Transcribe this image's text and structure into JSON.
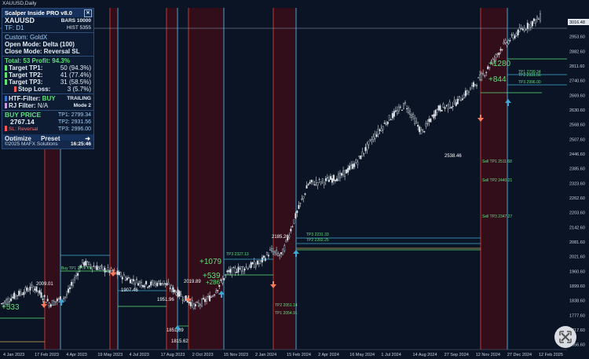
{
  "window": {
    "title": "XAUUSD,Daily"
  },
  "panel": {
    "title": "Scalper Inside PRO v8.0",
    "symbol": "XAUUSD",
    "tf": "TF: D1",
    "bars_label": "BARS",
    "bars": "10000",
    "hist_label": "HIST",
    "hist": "5355",
    "custom": "Custom: GoldX",
    "open_mode": "Open Mode: Delta (100)",
    "close_mode": "Close Mode: Reversal SL",
    "total": "Total: 53  Profit: 94.3%",
    "tp1": "Target TP1:",
    "tp1v": "50 (94.3%)",
    "tp2": "Target TP2:",
    "tp2v": "41 (77.4%)",
    "tp3": "Target TP3:",
    "tp3v": "31 (58.5%)",
    "sl": "Stop Loss:",
    "slv": "3 (5.7%)",
    "htf": "HTF-Filter:",
    "htfv": "BUY",
    "rj": "RJ Filter:",
    "rjv": "N/A",
    "trailing": "TRAILING",
    "mode": "Mode 2",
    "buy_price": "BUY PRICE",
    "buy_val": "2767.14",
    "bt1": "TP1: 2799.34",
    "bt2": "TP2: 2931.56",
    "bt3": "TP3: 2996.00",
    "slrev": "SL: Reversal",
    "optimize": "Optimize",
    "preset": "Preset",
    "arrow": "➜",
    "copyright": "©2025 MAFX Solutions",
    "time": "16:25:46"
  },
  "chart_data": {
    "type": "candlestick",
    "symbol": "XAUUSD",
    "timeframe": "Daily",
    "y_ticks": [
      "3016.48",
      "2953.60",
      "2882.60",
      "2811.60",
      "2740.60",
      "2669.60",
      "2630.60",
      "2568.60",
      "2507.60",
      "2446.60",
      "2385.60",
      "2323.60",
      "2262.60",
      "2203.60",
      "2142.60",
      "2081.60",
      "2021.60",
      "1960.60",
      "1899.60",
      "1838.60",
      "1777.60",
      "1717.60",
      "1656.60"
    ],
    "x_ticks": [
      "4 Jan 2023",
      "17 Feb 2023",
      "4 Apr 2023",
      "19 May 2023",
      "4 Jul 2023",
      "17 Aug 2023",
      "2 Oct 2023",
      "15 Nov 2023",
      "2 Jan 2024",
      "15 Feb 2024",
      "2 Apr 2024",
      "16 May 2024",
      "1 Jul 2024",
      "14 Aug 2024",
      "27 Sep 2024",
      "12 Nov 2024",
      "27 Dec 2024",
      "12 Feb 2025"
    ],
    "current_price": "3016.48",
    "path": [
      [
        0,
        1830
      ],
      [
        0.03,
        1870
      ],
      [
        0.06,
        1900
      ],
      [
        0.09,
        1830
      ],
      [
        0.12,
        1860
      ],
      [
        0.15,
        2000
      ],
      [
        0.18,
        1980
      ],
      [
        0.21,
        1960
      ],
      [
        0.24,
        1930
      ],
      [
        0.27,
        1910
      ],
      [
        0.3,
        1920
      ],
      [
        0.33,
        1870
      ],
      [
        0.36,
        1820
      ],
      [
        0.39,
        1860
      ],
      [
        0.42,
        1960
      ],
      [
        0.45,
        1980
      ],
      [
        0.48,
        2000
      ],
      [
        0.5,
        2050
      ],
      [
        0.52,
        2030
      ],
      [
        0.54,
        2160
      ],
      [
        0.57,
        2330
      ],
      [
        0.6,
        2340
      ],
      [
        0.63,
        2360
      ],
      [
        0.66,
        2420
      ],
      [
        0.69,
        2520
      ],
      [
        0.72,
        2600
      ],
      [
        0.75,
        2660
      ],
      [
        0.78,
        2540
      ],
      [
        0.81,
        2640
      ],
      [
        0.84,
        2660
      ],
      [
        0.87,
        2720
      ],
      [
        0.9,
        2800
      ],
      [
        0.93,
        2900
      ],
      [
        0.96,
        2960
      ],
      [
        1.0,
        3020
      ]
    ],
    "annotations": [
      "+1280",
      "+844",
      "+1079",
      "+539",
      "+286",
      "+533",
      "2185.26",
      "2538.46",
      "1907.46",
      "1951.96",
      "2009.01",
      "2019.89",
      "1851.69",
      "1815.62"
    ],
    "tp_labels": [
      "TP1 2799.34",
      "TP2 2931.56",
      "TP3 2996.00",
      "Sell TP1 2511.68",
      "Sell TP2 2440.21",
      "Sell TP3 2347.27",
      "Buy TP1 2777.76",
      "TP3 2327.13",
      "TP2 2051.14",
      "TP1 2054.91",
      "TP3 2231.33",
      "TP2 2202.25"
    ]
  }
}
